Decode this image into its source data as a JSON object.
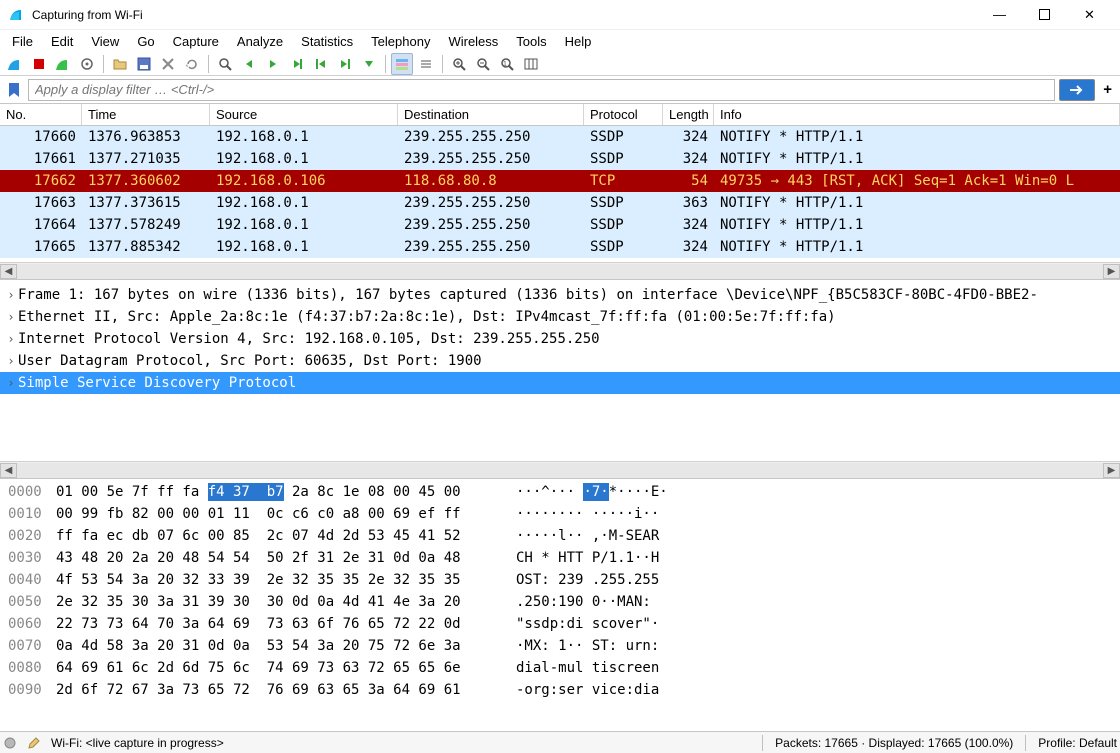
{
  "window": {
    "title": "Capturing from Wi-Fi"
  },
  "menu": [
    "File",
    "Edit",
    "View",
    "Go",
    "Capture",
    "Analyze",
    "Statistics",
    "Telephony",
    "Wireless",
    "Tools",
    "Help"
  ],
  "filter": {
    "placeholder": "Apply a display filter … <Ctrl-/>"
  },
  "columns": {
    "no": "No.",
    "time": "Time",
    "src": "Source",
    "dst": "Destination",
    "proto": "Protocol",
    "len": "Length",
    "info": "Info"
  },
  "packets": [
    {
      "no": "17660",
      "time": "1376.963853",
      "src": "192.168.0.1",
      "dst": "239.255.255.250",
      "proto": "SSDP",
      "len": "324",
      "info": "NOTIFY * HTTP/1.1",
      "class": "ssdp"
    },
    {
      "no": "17661",
      "time": "1377.271035",
      "src": "192.168.0.1",
      "dst": "239.255.255.250",
      "proto": "SSDP",
      "len": "324",
      "info": "NOTIFY * HTTP/1.1",
      "class": "ssdp"
    },
    {
      "no": "17662",
      "time": "1377.360602",
      "src": "192.168.0.106",
      "dst": "118.68.80.8",
      "proto": "TCP",
      "len": "54",
      "info": "49735 → 443 [RST, ACK] Seq=1 Ack=1 Win=0 L",
      "class": "tcp-rst"
    },
    {
      "no": "17663",
      "time": "1377.373615",
      "src": "192.168.0.1",
      "dst": "239.255.255.250",
      "proto": "SSDP",
      "len": "363",
      "info": "NOTIFY * HTTP/1.1",
      "class": "ssdp"
    },
    {
      "no": "17664",
      "time": "1377.578249",
      "src": "192.168.0.1",
      "dst": "239.255.255.250",
      "proto": "SSDP",
      "len": "324",
      "info": "NOTIFY * HTTP/1.1",
      "class": "ssdp"
    },
    {
      "no": "17665",
      "time": "1377.885342",
      "src": "192.168.0.1",
      "dst": "239.255.255.250",
      "proto": "SSDP",
      "len": "324",
      "info": "NOTIFY * HTTP/1.1",
      "class": "ssdp"
    }
  ],
  "details": [
    {
      "text": "Frame 1: 167 bytes on wire (1336 bits), 167 bytes captured (1336 bits) on interface \\Device\\NPF_{B5C583CF-80BC-4FD0-BBE2-",
      "sel": false
    },
    {
      "text": "Ethernet II, Src: Apple_2a:8c:1e (f4:37:b7:2a:8c:1e), Dst: IPv4mcast_7f:ff:fa (01:00:5e:7f:ff:fa)",
      "sel": false
    },
    {
      "text": "Internet Protocol Version 4, Src: 192.168.0.105, Dst: 239.255.255.250",
      "sel": false
    },
    {
      "text": "User Datagram Protocol, Src Port: 60635, Dst Port: 1900",
      "sel": false
    },
    {
      "text": "Simple Service Discovery Protocol",
      "sel": true
    }
  ],
  "hex": [
    {
      "off": "0000",
      "b1": "01 00 5e 7f ff fa ",
      "bhl": "f4 37  b7",
      "b2": " 2a 8c 1e 08 00 45 00",
      "a1": "···^··· ",
      "ahl": "·7·",
      "a2": "*····E·"
    },
    {
      "off": "0010",
      "b": "00 99 fb 82 00 00 01 11  0c c6 c0 a8 00 69 ef ff",
      "a": "········ ·····i··"
    },
    {
      "off": "0020",
      "b": "ff fa ec db 07 6c 00 85  2c 07 4d 2d 53 45 41 52",
      "a": "·····l·· ,·M-SEAR"
    },
    {
      "off": "0030",
      "b": "43 48 20 2a 20 48 54 54  50 2f 31 2e 31 0d 0a 48",
      "a": "CH * HTT P/1.1··H"
    },
    {
      "off": "0040",
      "b": "4f 53 54 3a 20 32 33 39  2e 32 35 35 2e 32 35 35",
      "a": "OST: 239 .255.255"
    },
    {
      "off": "0050",
      "b": "2e 32 35 30 3a 31 39 30  30 0d 0a 4d 41 4e 3a 20",
      "a": ".250:190 0··MAN: "
    },
    {
      "off": "0060",
      "b": "22 73 73 64 70 3a 64 69  73 63 6f 76 65 72 22 0d",
      "a": "\"ssdp:di scover\"·"
    },
    {
      "off": "0070",
      "b": "0a 4d 58 3a 20 31 0d 0a  53 54 3a 20 75 72 6e 3a",
      "a": "·MX: 1·· ST: urn:"
    },
    {
      "off": "0080",
      "b": "64 69 61 6c 2d 6d 75 6c  74 69 73 63 72 65 65 6e",
      "a": "dial-mul tiscreen"
    },
    {
      "off": "0090",
      "b": "2d 6f 72 67 3a 73 65 72  76 69 63 65 3a 64 69 61",
      "a": "-org:ser vice:dia"
    }
  ],
  "status": {
    "iface": "Wi-Fi: <live capture in progress>",
    "packets": "Packets: 17665 · Displayed: 17665 (100.0%)",
    "profile": "Profile: Default"
  }
}
